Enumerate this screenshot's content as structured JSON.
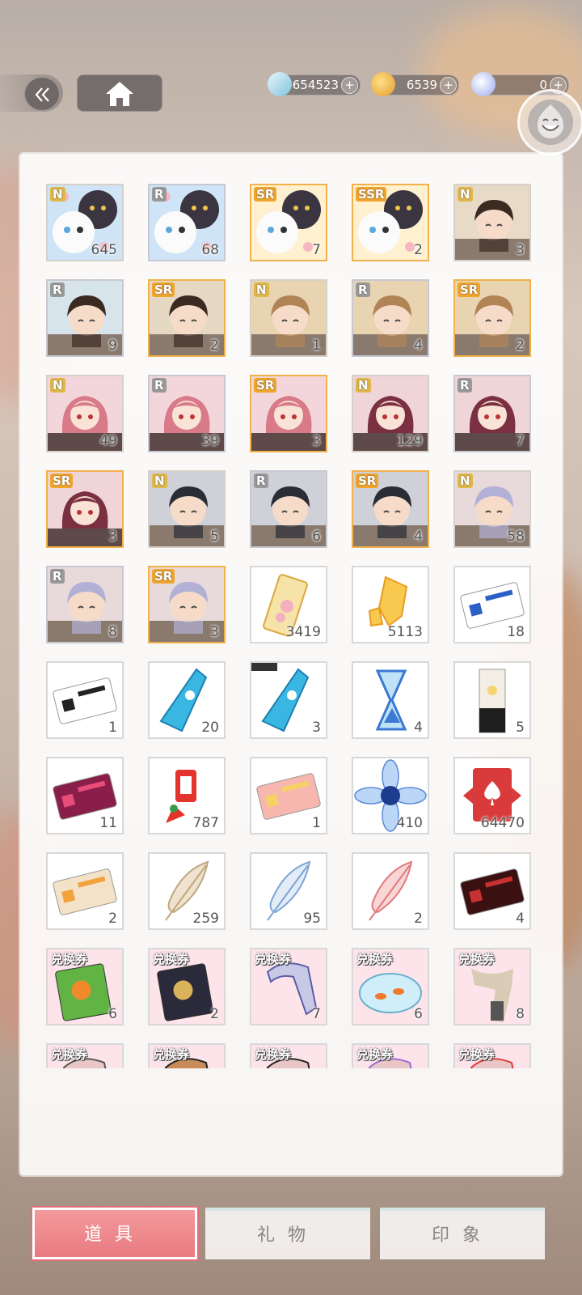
{
  "header": {
    "back_icon": "double-chevron-left-icon",
    "home_icon": "home-icon"
  },
  "currencies": [
    {
      "name": "ticket-currency",
      "value": "654523",
      "color": "#9fd6e8"
    },
    {
      "name": "gold-currency",
      "value": "6539",
      "color": "#f2b44b"
    },
    {
      "name": "crystal-currency",
      "value": "0",
      "color": "#a7b6f3"
    }
  ],
  "items": [
    {
      "rarity": "N",
      "count": "645",
      "kind": "cats",
      "c1": "#cfe4f6",
      "c2": "#3a3540"
    },
    {
      "rarity": "R",
      "count": "68",
      "kind": "cats",
      "c1": "#cfe4f6",
      "c2": "#3a3540"
    },
    {
      "rarity": "SR",
      "count": "7",
      "kind": "cats",
      "c1": "#fff1cf",
      "c2": "#3a3540"
    },
    {
      "rarity": "SSR",
      "count": "2",
      "kind": "cats",
      "c1": "#fff1cf",
      "c2": "#3a3540"
    },
    {
      "rarity": "N",
      "count": "3",
      "kind": "boy",
      "c1": "#e7dac7",
      "c2": "#3a2a22"
    },
    {
      "rarity": "R",
      "count": "9",
      "kind": "boy",
      "c1": "#d8e4ec",
      "c2": "#3a2a22"
    },
    {
      "rarity": "SR",
      "count": "2",
      "kind": "boy",
      "c1": "#e6d9c4",
      "c2": "#3a2a22"
    },
    {
      "rarity": "N",
      "count": "1",
      "kind": "boy",
      "c1": "#e9d4b2",
      "c2": "#b18455"
    },
    {
      "rarity": "R",
      "count": "4",
      "kind": "boy",
      "c1": "#e9d4b2",
      "c2": "#b18455"
    },
    {
      "rarity": "SR",
      "count": "2",
      "kind": "boy",
      "c1": "#e9d4b2",
      "c2": "#b18455"
    },
    {
      "rarity": "N",
      "count": "49",
      "kind": "girl",
      "c1": "#f3d6dc",
      "c2": "#d87a88"
    },
    {
      "rarity": "R",
      "count": "39",
      "kind": "girl",
      "c1": "#f3d6dc",
      "c2": "#d87a88"
    },
    {
      "rarity": "SR",
      "count": "3",
      "kind": "girl",
      "c1": "#f3d6dc",
      "c2": "#d87a88"
    },
    {
      "rarity": "N",
      "count": "129",
      "kind": "girl",
      "c1": "#efd5d8",
      "c2": "#7a3040"
    },
    {
      "rarity": "R",
      "count": "7",
      "kind": "girl",
      "c1": "#efd5d8",
      "c2": "#7a3040"
    },
    {
      "rarity": "SR",
      "count": "3",
      "kind": "girl",
      "c1": "#efd5d8",
      "c2": "#7a3040"
    },
    {
      "rarity": "N",
      "count": "5",
      "kind": "boy",
      "c1": "#cfd0d8",
      "c2": "#2a2c36"
    },
    {
      "rarity": "R",
      "count": "6",
      "kind": "boy",
      "c1": "#cfd0d8",
      "c2": "#2a2c36"
    },
    {
      "rarity": "SR",
      "count": "4",
      "kind": "boy",
      "c1": "#cfd0d8",
      "c2": "#2a2c36"
    },
    {
      "rarity": "N",
      "count": "58",
      "kind": "boy",
      "c1": "#e8dada",
      "c2": "#b2b0d6"
    },
    {
      "rarity": "R",
      "count": "8",
      "kind": "boy",
      "c1": "#e8dada",
      "c2": "#b2b0d6"
    },
    {
      "rarity": "SR",
      "count": "3",
      "kind": "boy",
      "c1": "#e8dada",
      "c2": "#b2b0d6"
    },
    {
      "count": "3419",
      "kind": "bookmark",
      "c1": "#f6e3a8",
      "c2": "#f4b0c0"
    },
    {
      "count": "5113",
      "kind": "crystals",
      "c1": "#f9c94f",
      "c2": "#e79b22"
    },
    {
      "count": "18",
      "kind": "card",
      "c1": "#ffffff",
      "c2": "#2c5fc5"
    },
    {
      "count": "1",
      "kind": "card",
      "c1": "#ffffff",
      "c2": "#222222"
    },
    {
      "count": "20",
      "kind": "bottle",
      "c1": "#39b7e2",
      "c2": "#1d7fb0"
    },
    {
      "count": "3",
      "kind": "bottle",
      "c1": "#39b7e2",
      "c2": "#1d7fb0",
      "locked": true
    },
    {
      "count": "4",
      "kind": "hourglass",
      "c1": "#bfe2f6",
      "c2": "#3b79d2"
    },
    {
      "count": "5",
      "kind": "pillar",
      "c1": "#f5d46f",
      "c2": "#1e1e1e"
    },
    {
      "count": "11",
      "kind": "card",
      "c1": "#8a1e4a",
      "c2": "#e84c78"
    },
    {
      "count": "787",
      "kind": "charm",
      "c1": "#e2332c",
      "c2": "#f3c84f"
    },
    {
      "count": "1",
      "kind": "card",
      "c1": "#f7b7ae",
      "c2": "#f4d266"
    },
    {
      "count": "410",
      "kind": "flower",
      "c1": "#bcd6f7",
      "c2": "#1e3c8e"
    },
    {
      "count": "64470",
      "kind": "poker",
      "c1": "#d93a3a",
      "c2": "#ffffff"
    },
    {
      "count": "2",
      "kind": "card",
      "c1": "#f3e2c7",
      "c2": "#f2a23b"
    },
    {
      "count": "259",
      "kind": "feather",
      "c1": "#efe3cf",
      "c2": "#bfa77e"
    },
    {
      "count": "95",
      "kind": "feather",
      "c1": "#e3edf8",
      "c2": "#7ea4d6"
    },
    {
      "count": "2",
      "kind": "feather",
      "c1": "#f9d6d6",
      "c2": "#e07a7a"
    },
    {
      "count": "4",
      "kind": "card",
      "c1": "#3a1010",
      "c2": "#c73131"
    },
    {
      "count": "6",
      "kind": "book",
      "tag": "兑换券",
      "c1": "#61b443",
      "c2": "#f08a2a"
    },
    {
      "count": "2",
      "kind": "book",
      "tag": "兑换券",
      "c1": "#2a2a3a",
      "c2": "#d9b25a"
    },
    {
      "count": "7",
      "kind": "tool",
      "tag": "兑换券",
      "c1": "#c7c9e6",
      "c2": "#5a5ea6"
    },
    {
      "count": "6",
      "kind": "bowl",
      "tag": "兑换券",
      "c1": "#cfeef9",
      "c2": "#f07a2a"
    },
    {
      "count": "8",
      "kind": "scarf",
      "tag": "兑换券",
      "c1": "#d9cbb5",
      "c2": "#555555"
    },
    {
      "count": "",
      "kind": "tool",
      "tag": "兑换券",
      "c1": "#e9c7c7",
      "c2": "#555555"
    },
    {
      "count": "",
      "kind": "tool",
      "tag": "兑换券",
      "c1": "#c98b5a",
      "c2": "#222222"
    },
    {
      "count": "",
      "kind": "tool",
      "tag": "兑换券",
      "c1": "#e9c7c7",
      "c2": "#222222"
    },
    {
      "count": "",
      "kind": "tool",
      "tag": "兑换券",
      "c1": "#e9c7c7",
      "c2": "#9a6ad6"
    },
    {
      "count": "",
      "kind": "tool",
      "tag": "兑换券",
      "c1": "#e9c7c7",
      "c2": "#e23a3a"
    }
  ],
  "tabs": [
    {
      "label": "道具",
      "active": true
    },
    {
      "label": "礼物",
      "active": false
    },
    {
      "label": "印象",
      "active": false
    }
  ]
}
